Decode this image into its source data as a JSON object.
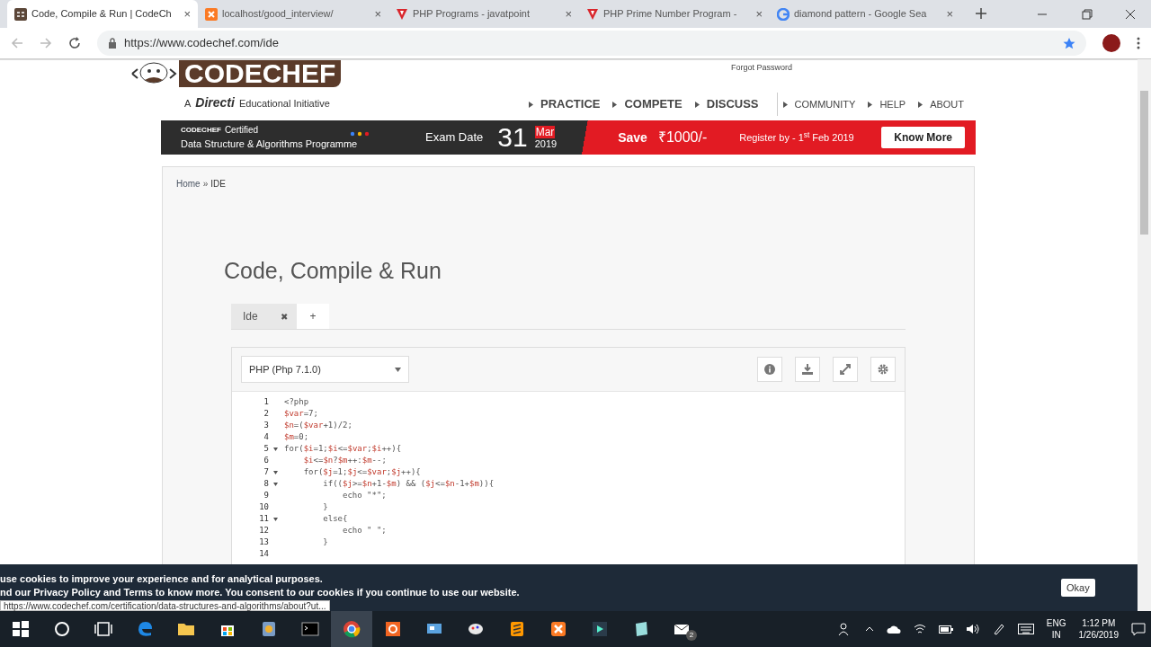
{
  "browser": {
    "tabs": [
      {
        "title": "Code, Compile & Run | CodeCh",
        "close": "×",
        "selected": true
      },
      {
        "title": "localhost/good_interview/",
        "close": "×",
        "selected": false
      },
      {
        "title": "PHP Programs - javatpoint",
        "close": "×",
        "selected": false
      },
      {
        "title": "PHP Prime Number Program -",
        "close": "×",
        "selected": false
      },
      {
        "title": "diamond pattern - Google Sea",
        "close": "×",
        "selected": false
      }
    ],
    "url": "https://www.codechef.com/ide"
  },
  "header": {
    "logo": "CODECHEF",
    "tagline_prefix": "A",
    "tagline_brand": "Directi",
    "tagline": "Educational Initiative",
    "forgot_password": "Forgot Password",
    "nav": [
      {
        "label": "PRACTICE",
        "kind": "main"
      },
      {
        "label": "COMPETE",
        "kind": "main"
      },
      {
        "label": "DISCUSS",
        "kind": "main"
      },
      {
        "label": "COMMUNITY",
        "kind": "minor"
      },
      {
        "label": "HELP",
        "kind": "minor"
      },
      {
        "label": "ABOUT",
        "kind": "minor"
      }
    ]
  },
  "banner": {
    "brand": "CODECHEF",
    "certified": "Certified",
    "programme": "Data Structure & Algorithms Programme",
    "exam_label": "Exam Date",
    "day": "31",
    "month": "Mar",
    "year": "2019",
    "save": "Save",
    "amount": "₹1000/-",
    "register": "Register by - 1$^{st}$ Feb 2019",
    "button": "Know More"
  },
  "breadcrumb": {
    "home": "Home",
    "separator": "»",
    "current": "IDE"
  },
  "title": "Code, Compile & Run",
  "ide_tabs": [
    {
      "label": "Ide",
      "close": "✖",
      "selected": true
    },
    {
      "label": "+",
      "selected": false
    }
  ],
  "language": "PHP (Php 7.1.0)",
  "editor_lines": [
    {
      "n": "1",
      "fold": false,
      "text": "<?php"
    },
    {
      "n": "2",
      "fold": false,
      "text": "$var=7;"
    },
    {
      "n": "3",
      "fold": false,
      "text": "$n=($var+1)/2;"
    },
    {
      "n": "4",
      "fold": false,
      "text": "$m=0;"
    },
    {
      "n": "5",
      "fold": true,
      "text": "for($i=1;$i<=$var;$i++){"
    },
    {
      "n": "6",
      "fold": false,
      "text": "    $i<=$n?$m++:$m--;"
    },
    {
      "n": "7",
      "fold": true,
      "text": "    for($j=1;$j<=$var;$j++){"
    },
    {
      "n": "8",
      "fold": true,
      "text": "        if(($j>=$n+1-$m) && ($j<=$n-1+$m)){"
    },
    {
      "n": "9",
      "fold": false,
      "text": "            echo \"*\";"
    },
    {
      "n": "10",
      "fold": false,
      "text": "        }"
    },
    {
      "n": "11",
      "fold": true,
      "text": "        else{"
    },
    {
      "n": "12",
      "fold": false,
      "text": "            echo \" \";"
    },
    {
      "n": "13",
      "fold": false,
      "text": "        }"
    },
    {
      "n": "14",
      "fold": false
    }
  ],
  "cookie_bar": {
    "line_1": "use cookies to improve your experience and for analytical purposes.",
    "line_2": "nd our **Privacy Policy** and **Terms** to know more. You consent to our cookies if you continue to use our website.",
    "button": "Okay"
  },
  "status_url": "https://www.codechef.com/certification/data-structures-and-algorithms/about?ut...",
  "taskbar": {
    "mail_badge": "2",
    "language": "ENG",
    "region": "IN",
    "time": "1:12 PM",
    "date": "1/26/2019"
  }
}
